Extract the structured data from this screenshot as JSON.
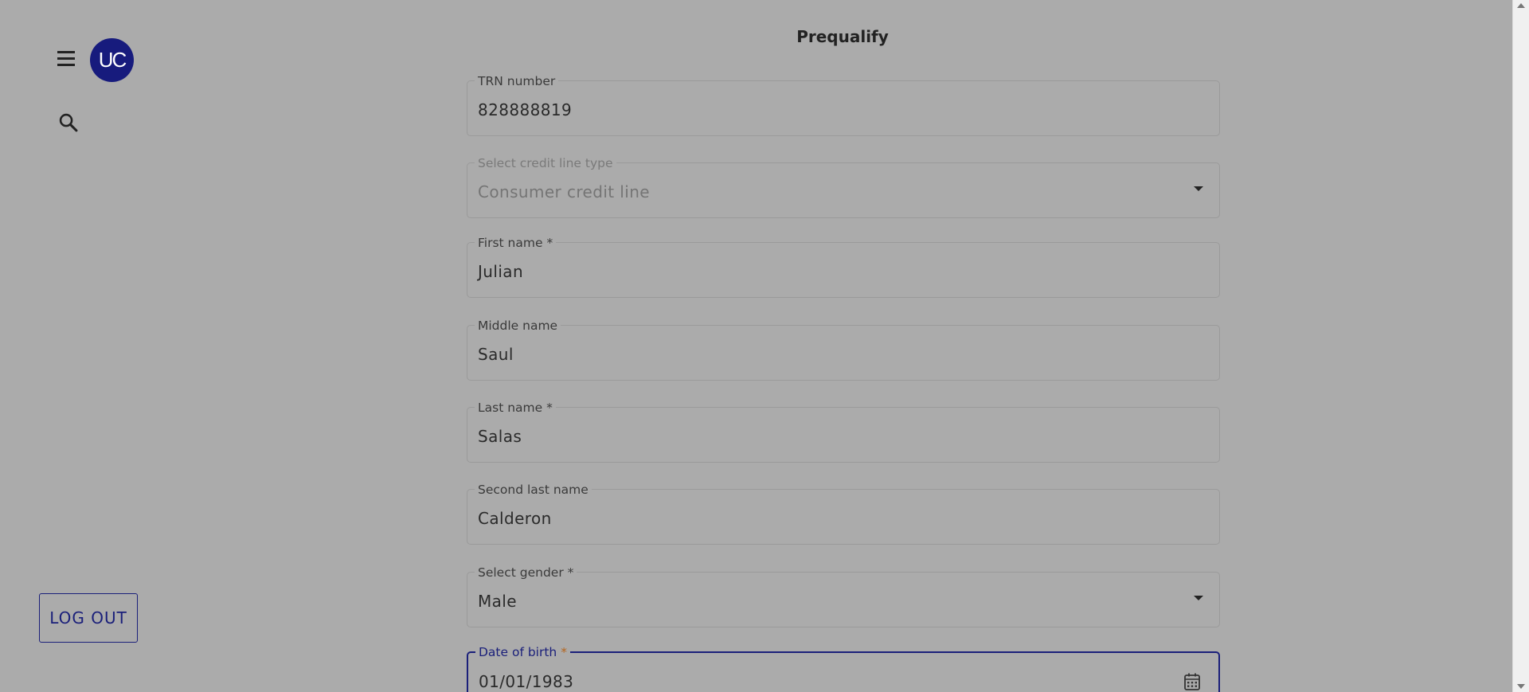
{
  "app": {
    "logo_text": "UC"
  },
  "nav": {
    "logout_label": "LOG OUT"
  },
  "page": {
    "title": "Prequalify"
  },
  "form": {
    "trn": {
      "label": "TRN number",
      "value": "828888819"
    },
    "credit_line": {
      "label": "Select credit line type",
      "value": "Consumer credit line"
    },
    "first_name": {
      "label": "First name",
      "required_mark": "*",
      "value": "Julian"
    },
    "middle_name": {
      "label": "Middle name",
      "value": "Saul"
    },
    "last_name": {
      "label": "Last name",
      "required_mark": "*",
      "value": "Salas"
    },
    "second_last_name": {
      "label": "Second last name",
      "value": "Calderon"
    },
    "gender": {
      "label": "Select gender",
      "required_mark": "*",
      "value": "Male"
    },
    "dob": {
      "label": "Date of birth",
      "required_mark": "*",
      "value": "01/01/1983"
    }
  },
  "icons": {
    "menu": "menu-icon",
    "search": "search-icon",
    "calendar": "calendar-icon",
    "dropdown": "chevron-down-icon"
  },
  "colors": {
    "background": "#ababab",
    "primary": "#1a1f7a",
    "logo_bg": "#171b7d"
  }
}
